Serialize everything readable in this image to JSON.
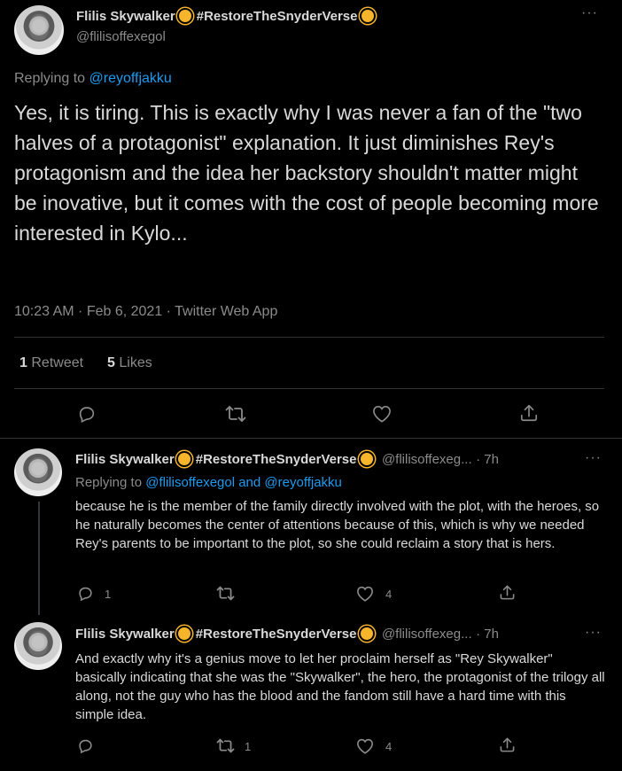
{
  "main_tweet": {
    "display_name": "Flilis Skywalker",
    "hashtag": "#RestoreTheSnyderVerse",
    "handle": "@flilisoffexegol",
    "replying_label": "Replying to",
    "replying_to": "@reyoffjakku",
    "text": "Yes, it is tiring. This is exactly why I was never a fan of the \"two halves of a protagonist\" explanation. It just diminishes Rey's protagonism and the idea her backstory shouldn't matter might be inovative, but it comes with the cost of people becoming more interested in Kylo...",
    "timestamp": "10:23 AM · Feb 6, 2021 · Twitter Web App",
    "retweets_count": "1",
    "retweets_label": "Retweet",
    "likes_count": "5",
    "likes_label": "Likes"
  },
  "replies": [
    {
      "display_name": "Flilis Skywalker",
      "hashtag": "#RestoreTheSnyderVerse",
      "handle": "@flilisoffexeg...",
      "time": "· 7h",
      "replying_label": "Replying to",
      "replying_to": "@flilisoffexegol and @reyoffjakku",
      "text": "because he is the member of the family directly involved with the plot, with the heroes, so he naturally becomes the center of attentions because of this, which is why we needed Rey's parents to be important to the plot, so she could reclaim a story that is hers.",
      "reply_count": "1",
      "retweet_count": "",
      "like_count": "4"
    },
    {
      "display_name": "Flilis Skywalker",
      "hashtag": "#RestoreTheSnyderVerse",
      "handle": "@flilisoffexeg...",
      "time": "· 7h",
      "text": "And exactly why it's a genius move to let her proclaim herself as \"Rey Skywalker\" basically indicating that she was the \"Skywalker\", the hero, the protagonist of the trilogy all along, not the guy who has the blood and the fandom still have a hard time with this simple idea.",
      "reply_count": "",
      "retweet_count": "1",
      "like_count": "4"
    }
  ],
  "icons": {
    "more": "more-icon",
    "reply": "reply-icon",
    "retweet": "retweet-icon",
    "like": "like-icon",
    "share": "share-icon",
    "sun": "sun-emoji-icon"
  },
  "colors": {
    "background": "#000000",
    "text": "#d9d9d9",
    "muted": "#8b8b8b",
    "link": "#1d9bf0",
    "divider": "#2f3336"
  }
}
